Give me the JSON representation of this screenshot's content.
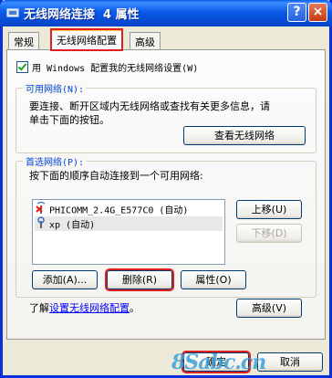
{
  "window": {
    "title": "无线网络连接  4 属性",
    "help_label": "?",
    "close_label": "×"
  },
  "tabs": [
    {
      "label": "常规"
    },
    {
      "label": "无线网络配置"
    },
    {
      "label": "高级"
    }
  ],
  "config": {
    "checkbox_label": "用 Windows 配置我的无线网络设置(W)",
    "checkbox_checked": true
  },
  "available": {
    "legend": "可用网络(N):",
    "description_line1": "要连接、断开区域内无线网络或查找有关更多信息，请",
    "description_line2": "单击下面的按钮。",
    "view_button": "查看无线网络"
  },
  "preferred": {
    "legend": "首选网络(P):",
    "description": "按下面的顺序自动连接到一个可用网络:",
    "networks": [
      {
        "name": "PHICOMM_2.4G_E577C0 (自动)",
        "icon": "wireless-x-icon"
      },
      {
        "name": "xp (自动)",
        "icon": "wireless-connected-icon"
      }
    ],
    "move_up": "上移(U)",
    "move_down": "下移(D)",
    "add": "添加(A)...",
    "remove": "删除(R)",
    "properties": "属性(O)"
  },
  "footer": {
    "learn_prefix": "了解",
    "learn_link": "设置无线网络配置",
    "learn_suffix": "。",
    "advanced": "高级(V)",
    "ok": "确定",
    "cancel": "取消"
  },
  "watermark": "8Sabc.cn"
}
